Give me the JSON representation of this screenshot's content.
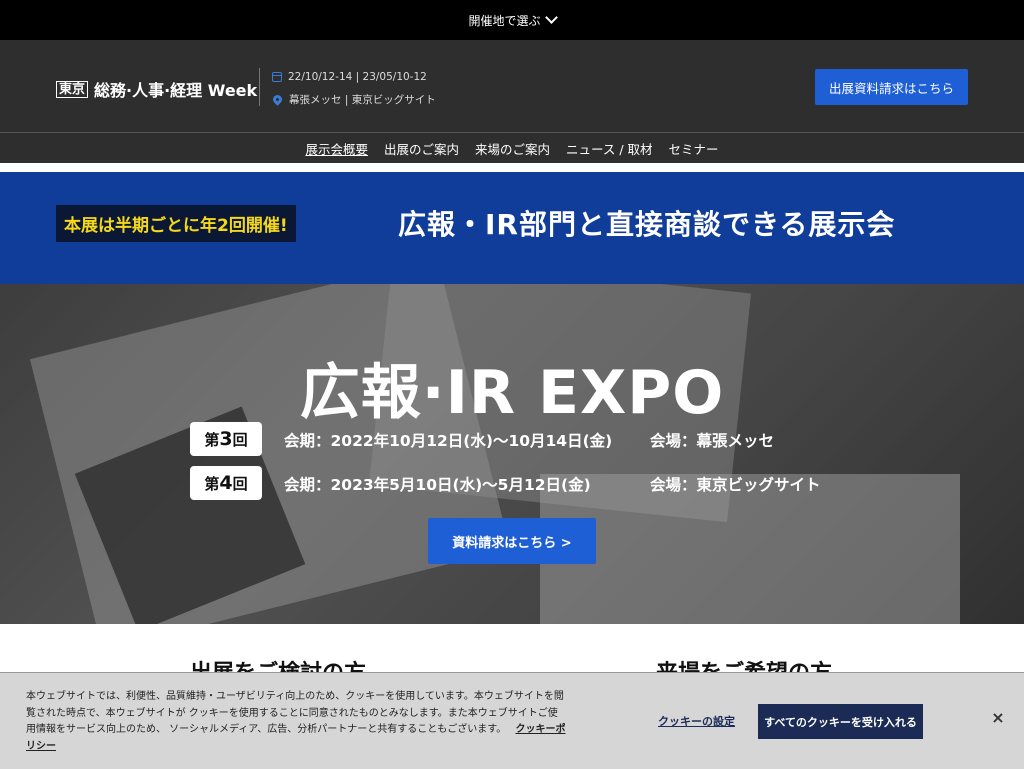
{
  "topbar": {
    "label": "開催地で選ぶ"
  },
  "header": {
    "brand_box": "東京",
    "brand_text": "総務·人事·経理 Week",
    "dates": "22/10/12-14 | 23/05/10-12",
    "venues": "幕張メッセ | 東京ビッグサイト",
    "request_button": "出展資料請求はこちら"
  },
  "nav": {
    "items": [
      "展示会概要",
      "出展のご案内",
      "来場のご案内",
      "ニュース / 取材",
      "セミナー"
    ]
  },
  "banner": {
    "badge": "本展は半期ごとに年2回開催!",
    "title": "広報・IR部門と直接商談できる展示会"
  },
  "hero": {
    "title": "広報·IR EXPO",
    "editions": [
      {
        "label_prefix": "第",
        "number": "3",
        "label_suffix": "回",
        "period": "会期：2022年10月12日(水)〜10月14日(金)",
        "venue": "会場：幕張メッセ"
      },
      {
        "label_prefix": "第",
        "number": "4",
        "label_suffix": "回",
        "period": "会期：2023年5月10日(水)〜5月12日(金)",
        "venue": "会場：東京ビッグサイト"
      }
    ],
    "button": "資料請求はこちら >"
  },
  "sections": {
    "left": "出展をご検討の方",
    "right": "来場をご希望の方"
  },
  "cookie": {
    "text": "本ウェブサイトでは、利便性、品質維持・ユーザビリティ向上のため、クッキーを使用しています。本ウェブサイトを閲覧された時点で、本ウェブサイトが クッキーを使用することに同意されたものとみなします。また本ウェブサイトご使用情報をサービス向上のため、 ソーシャルメディア、広告、分析パートナーと共有することもございます。",
    "policy_link": "クッキーポリシー",
    "settings_link": "クッキーの設定",
    "accept_button": "すべてのクッキーを受け入れる",
    "close": "×"
  }
}
